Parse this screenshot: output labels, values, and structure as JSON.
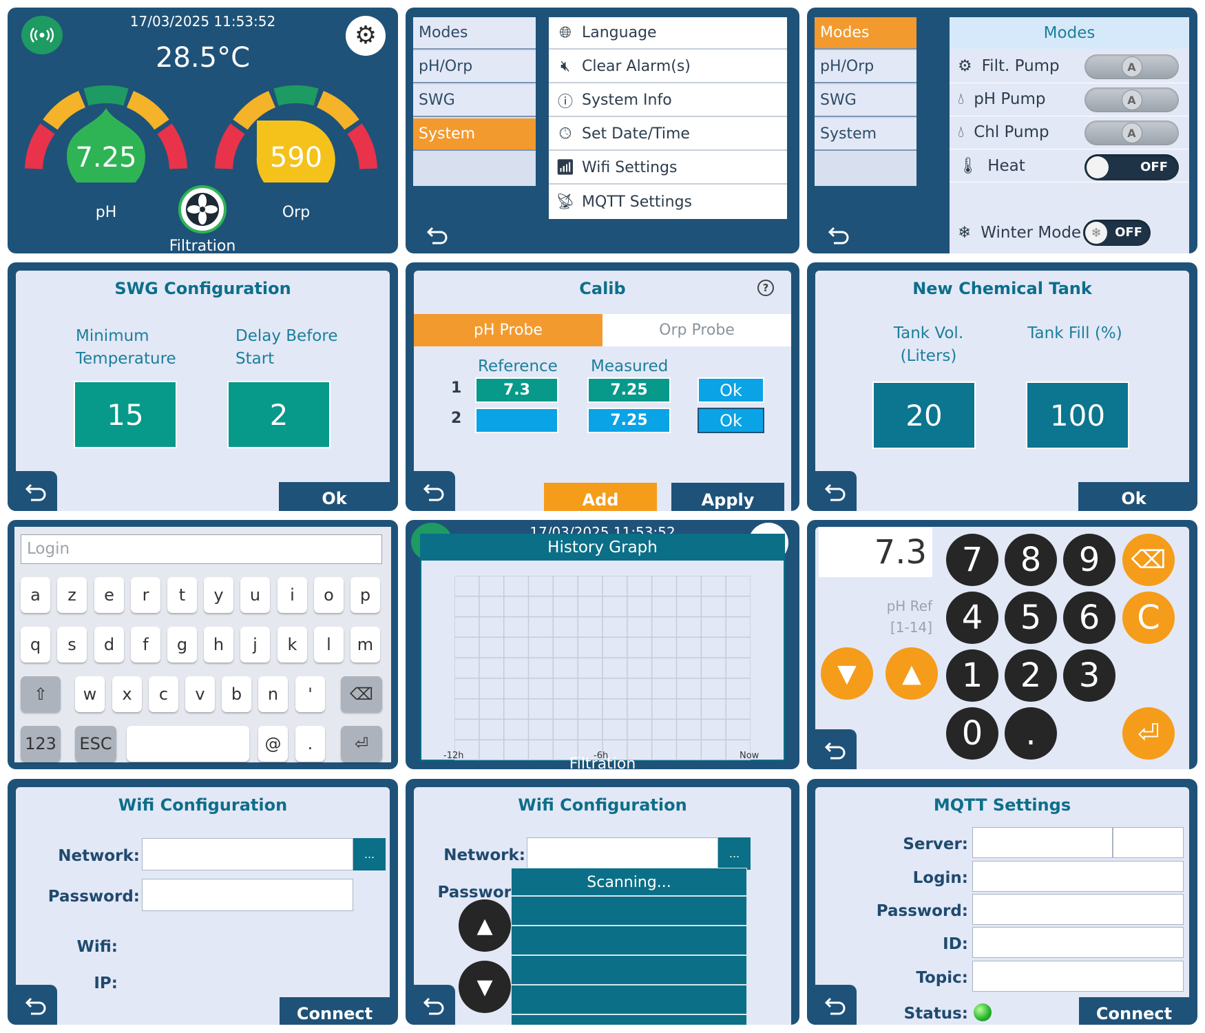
{
  "dashboard": {
    "datetime": "17/03/2025 11:53:52",
    "temperature": "28.5°C",
    "ph_value": "7.25",
    "ph_label": "pH",
    "orp_value": "590",
    "orp_label": "Orp",
    "filtration_label": "Filtration"
  },
  "system_menu": {
    "left_items": [
      "Modes",
      "pH/Orp",
      "SWG",
      "System"
    ],
    "active": "System",
    "sub_items": [
      {
        "icon": "globe-icon",
        "label": "Language"
      },
      {
        "icon": "mute-icon",
        "label": "Clear Alarm(s)"
      },
      {
        "icon": "info-icon",
        "label": "System Info"
      },
      {
        "icon": "clock-icon",
        "label": "Set Date/Time"
      },
      {
        "icon": "wifi-icon",
        "label": "Wifi Settings"
      },
      {
        "icon": "rss-icon",
        "label": "MQTT Settings"
      }
    ]
  },
  "modes_screen": {
    "left_items": [
      "Modes",
      "pH/Orp",
      "SWG",
      "System"
    ],
    "active": "Modes",
    "title": "Modes",
    "rows": [
      {
        "icon": "pump-icon",
        "label": "Filt. Pump",
        "switch": "A"
      },
      {
        "icon": "drop-icon",
        "label": "pH Pump",
        "switch": "A"
      },
      {
        "icon": "drop-outline-icon",
        "label": "Chl Pump",
        "switch": "A"
      },
      {
        "icon": "heat-icon",
        "label": "Heat",
        "switch": "OFF"
      }
    ],
    "winter_label": "Winter Mode",
    "winter_state": "OFF"
  },
  "swg_config": {
    "title": "SWG Configuration",
    "label1_line1": "Minimum",
    "label1_line2": "Temperature",
    "label2_line1": "Delay Before",
    "label2_line2": "Start",
    "value1": "15",
    "value2": "2",
    "ok": "Ok"
  },
  "calib": {
    "title": "Calib",
    "tab_ph": "pH Probe",
    "tab_orp": "Orp Probe",
    "col_ref": "Reference",
    "col_meas": "Measured",
    "rows": [
      {
        "num": "1",
        "reference": "7.3",
        "measured": "7.25",
        "ok": "Ok"
      },
      {
        "num": "2",
        "reference": "",
        "measured": "7.25",
        "ok": "Ok"
      }
    ],
    "add": "Add",
    "apply": "Apply"
  },
  "chem_tank": {
    "title": "New Chemical Tank",
    "label1_line1": "Tank Vol.",
    "label1_line2": "(Liters)",
    "label2": "Tank Fill (%)",
    "value1": "20",
    "value2": "100",
    "ok": "Ok"
  },
  "keyboard": {
    "placeholder": "Login",
    "row1": [
      "a",
      "z",
      "e",
      "r",
      "t",
      "y",
      "u",
      "i",
      "o",
      "p"
    ],
    "row2": [
      "q",
      "s",
      "d",
      "f",
      "g",
      "h",
      "j",
      "k",
      "l",
      "m"
    ],
    "row3": [
      "w",
      "x",
      "c",
      "v",
      "b",
      "n",
      "'"
    ],
    "num_key": "123",
    "esc_key": "ESC",
    "at_key": "@",
    "dot_key": "."
  },
  "history": {
    "datetime_bg": "17/03/2025 11:53:52",
    "title": "History Graph",
    "x_labels": [
      "-12h",
      "-6h",
      "Now"
    ],
    "bg_filtration": "Filtration"
  },
  "numpad": {
    "display": "7.3",
    "label_line1": "pH Ref",
    "label_line2": "[1-14]",
    "keys": [
      "7",
      "8",
      "9",
      "4",
      "5",
      "6",
      "1",
      "2",
      "3",
      "0",
      "."
    ],
    "clear": "C"
  },
  "wifi1": {
    "title": "Wifi Configuration",
    "network_label": "Network:",
    "password_label": "Password:",
    "dots": "...",
    "wifi_label": "Wifi:",
    "ip_label": "IP:",
    "connect": "Connect"
  },
  "wifi2": {
    "title": "Wifi Configuration",
    "network_label": "Network:",
    "password_label": "Passwor",
    "dots": "...",
    "scanning": "Scanning..."
  },
  "mqtt": {
    "title": "MQTT Settings",
    "server_label": "Server:",
    "login_label": "Login:",
    "password_label": "Password:",
    "id_label": "ID:",
    "topic_label": "Topic:",
    "status_label": "Status:",
    "connect": "Connect"
  },
  "colors": {
    "frame": "#1f5278",
    "panel_bg": "#e3e8f6",
    "accent_orange": "#f39a2e",
    "teal": "#07998a",
    "blue": "#0c7590"
  }
}
